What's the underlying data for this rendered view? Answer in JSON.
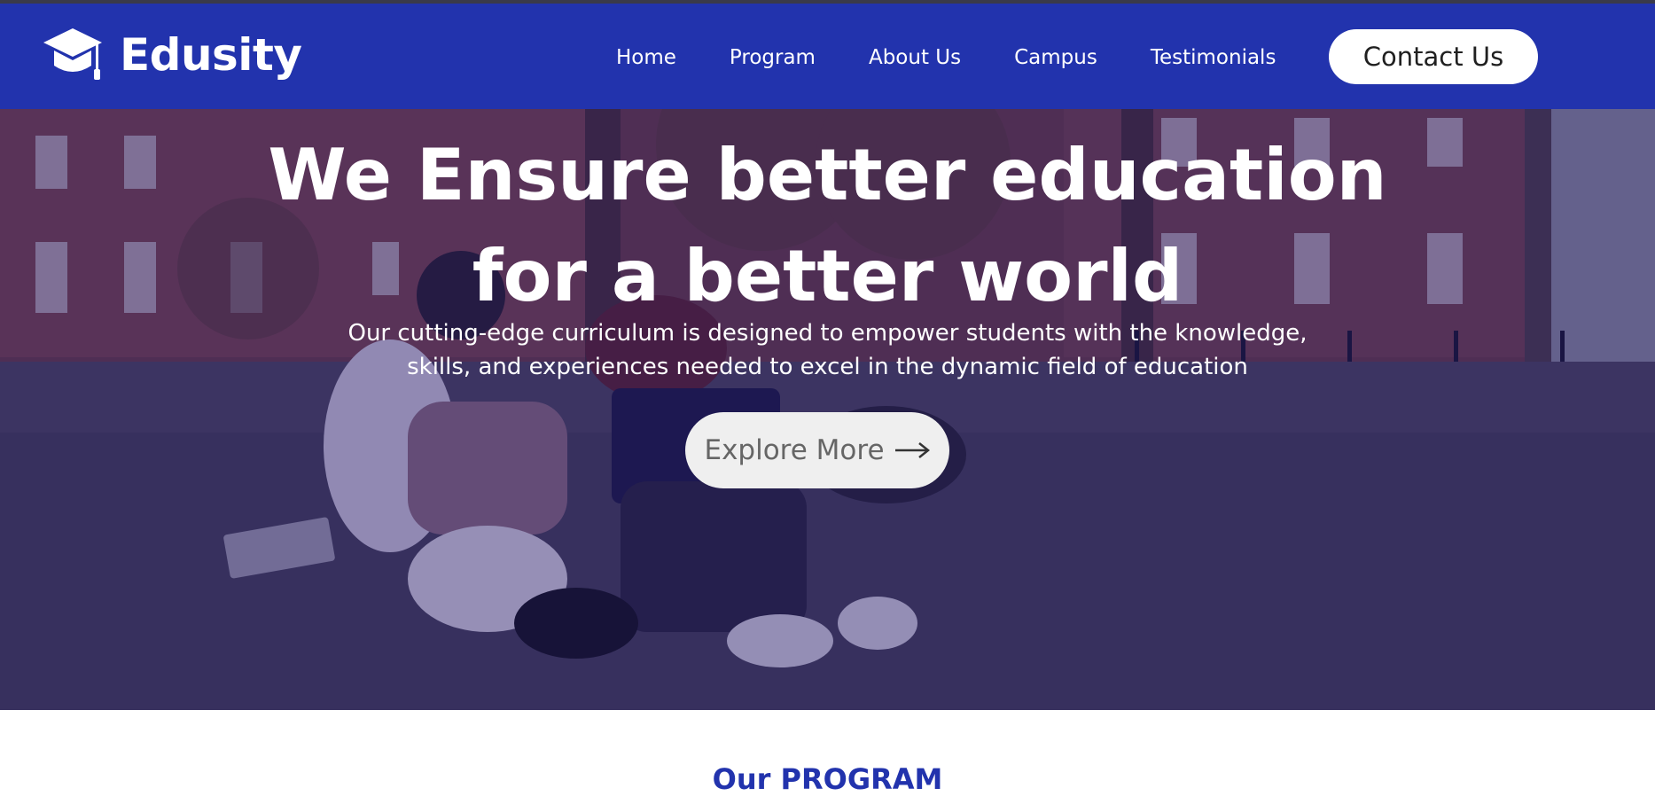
{
  "brand": {
    "name": "Edusity",
    "logo_icon": "graduation-cap-icon"
  },
  "nav": {
    "items": [
      {
        "label": "Home"
      },
      {
        "label": "Program"
      },
      {
        "label": "About Us"
      },
      {
        "label": "Campus"
      },
      {
        "label": "Testimonials"
      }
    ],
    "contact_label": "Contact Us"
  },
  "hero": {
    "title_line1": "We Ensure better education",
    "title_line2": "for a better world",
    "subtitle_line1": "Our cutting-edge curriculum is designed to empower students with the knowledge,",
    "subtitle_line2": "skills, and experiences needed to excel in the dynamic field of education",
    "button_label": "Explore More",
    "button_icon": "arrow-right-icon"
  },
  "programs": {
    "heading": "Our PROGRAM"
  },
  "colors": {
    "nav_bg": "#2233ad",
    "accent": "#2233ad",
    "hero_overlay": "#1c1466",
    "button_bg": "#efefef"
  }
}
